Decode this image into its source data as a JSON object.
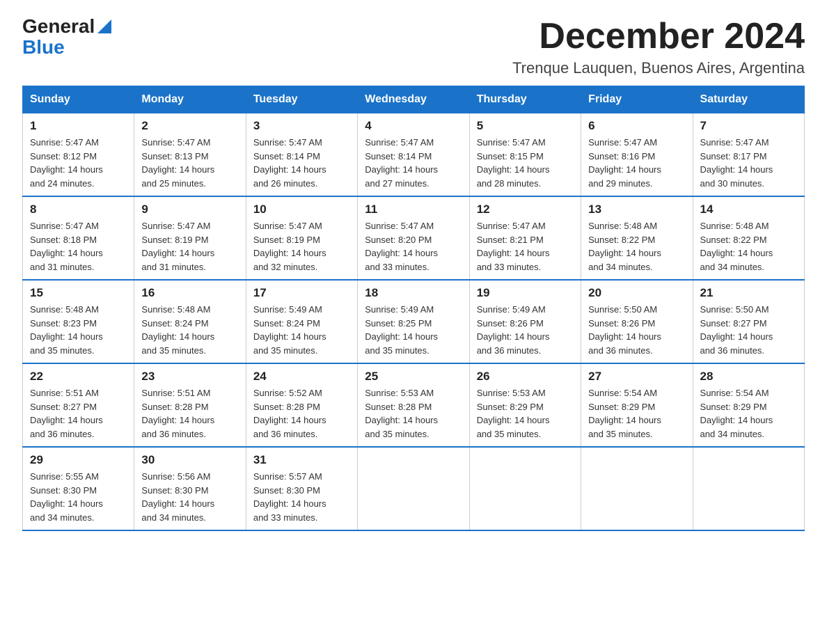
{
  "logo": {
    "general": "General",
    "blue": "Blue"
  },
  "title": "December 2024",
  "location": "Trenque Lauquen, Buenos Aires, Argentina",
  "headers": [
    "Sunday",
    "Monday",
    "Tuesday",
    "Wednesday",
    "Thursday",
    "Friday",
    "Saturday"
  ],
  "weeks": [
    [
      {
        "day": "1",
        "sunrise": "5:47 AM",
        "sunset": "8:12 PM",
        "daylight": "14 hours and 24 minutes."
      },
      {
        "day": "2",
        "sunrise": "5:47 AM",
        "sunset": "8:13 PM",
        "daylight": "14 hours and 25 minutes."
      },
      {
        "day": "3",
        "sunrise": "5:47 AM",
        "sunset": "8:14 PM",
        "daylight": "14 hours and 26 minutes."
      },
      {
        "day": "4",
        "sunrise": "5:47 AM",
        "sunset": "8:14 PM",
        "daylight": "14 hours and 27 minutes."
      },
      {
        "day": "5",
        "sunrise": "5:47 AM",
        "sunset": "8:15 PM",
        "daylight": "14 hours and 28 minutes."
      },
      {
        "day": "6",
        "sunrise": "5:47 AM",
        "sunset": "8:16 PM",
        "daylight": "14 hours and 29 minutes."
      },
      {
        "day": "7",
        "sunrise": "5:47 AM",
        "sunset": "8:17 PM",
        "daylight": "14 hours and 30 minutes."
      }
    ],
    [
      {
        "day": "8",
        "sunrise": "5:47 AM",
        "sunset": "8:18 PM",
        "daylight": "14 hours and 31 minutes."
      },
      {
        "day": "9",
        "sunrise": "5:47 AM",
        "sunset": "8:19 PM",
        "daylight": "14 hours and 31 minutes."
      },
      {
        "day": "10",
        "sunrise": "5:47 AM",
        "sunset": "8:19 PM",
        "daylight": "14 hours and 32 minutes."
      },
      {
        "day": "11",
        "sunrise": "5:47 AM",
        "sunset": "8:20 PM",
        "daylight": "14 hours and 33 minutes."
      },
      {
        "day": "12",
        "sunrise": "5:47 AM",
        "sunset": "8:21 PM",
        "daylight": "14 hours and 33 minutes."
      },
      {
        "day": "13",
        "sunrise": "5:48 AM",
        "sunset": "8:22 PM",
        "daylight": "14 hours and 34 minutes."
      },
      {
        "day": "14",
        "sunrise": "5:48 AM",
        "sunset": "8:22 PM",
        "daylight": "14 hours and 34 minutes."
      }
    ],
    [
      {
        "day": "15",
        "sunrise": "5:48 AM",
        "sunset": "8:23 PM",
        "daylight": "14 hours and 35 minutes."
      },
      {
        "day": "16",
        "sunrise": "5:48 AM",
        "sunset": "8:24 PM",
        "daylight": "14 hours and 35 minutes."
      },
      {
        "day": "17",
        "sunrise": "5:49 AM",
        "sunset": "8:24 PM",
        "daylight": "14 hours and 35 minutes."
      },
      {
        "day": "18",
        "sunrise": "5:49 AM",
        "sunset": "8:25 PM",
        "daylight": "14 hours and 35 minutes."
      },
      {
        "day": "19",
        "sunrise": "5:49 AM",
        "sunset": "8:26 PM",
        "daylight": "14 hours and 36 minutes."
      },
      {
        "day": "20",
        "sunrise": "5:50 AM",
        "sunset": "8:26 PM",
        "daylight": "14 hours and 36 minutes."
      },
      {
        "day": "21",
        "sunrise": "5:50 AM",
        "sunset": "8:27 PM",
        "daylight": "14 hours and 36 minutes."
      }
    ],
    [
      {
        "day": "22",
        "sunrise": "5:51 AM",
        "sunset": "8:27 PM",
        "daylight": "14 hours and 36 minutes."
      },
      {
        "day": "23",
        "sunrise": "5:51 AM",
        "sunset": "8:28 PM",
        "daylight": "14 hours and 36 minutes."
      },
      {
        "day": "24",
        "sunrise": "5:52 AM",
        "sunset": "8:28 PM",
        "daylight": "14 hours and 36 minutes."
      },
      {
        "day": "25",
        "sunrise": "5:53 AM",
        "sunset": "8:28 PM",
        "daylight": "14 hours and 35 minutes."
      },
      {
        "day": "26",
        "sunrise": "5:53 AM",
        "sunset": "8:29 PM",
        "daylight": "14 hours and 35 minutes."
      },
      {
        "day": "27",
        "sunrise": "5:54 AM",
        "sunset": "8:29 PM",
        "daylight": "14 hours and 35 minutes."
      },
      {
        "day": "28",
        "sunrise": "5:54 AM",
        "sunset": "8:29 PM",
        "daylight": "14 hours and 34 minutes."
      }
    ],
    [
      {
        "day": "29",
        "sunrise": "5:55 AM",
        "sunset": "8:30 PM",
        "daylight": "14 hours and 34 minutes."
      },
      {
        "day": "30",
        "sunrise": "5:56 AM",
        "sunset": "8:30 PM",
        "daylight": "14 hours and 34 minutes."
      },
      {
        "day": "31",
        "sunrise": "5:57 AM",
        "sunset": "8:30 PM",
        "daylight": "14 hours and 33 minutes."
      },
      null,
      null,
      null,
      null
    ]
  ],
  "labels": {
    "sunrise": "Sunrise:",
    "sunset": "Sunset:",
    "daylight": "Daylight:"
  }
}
